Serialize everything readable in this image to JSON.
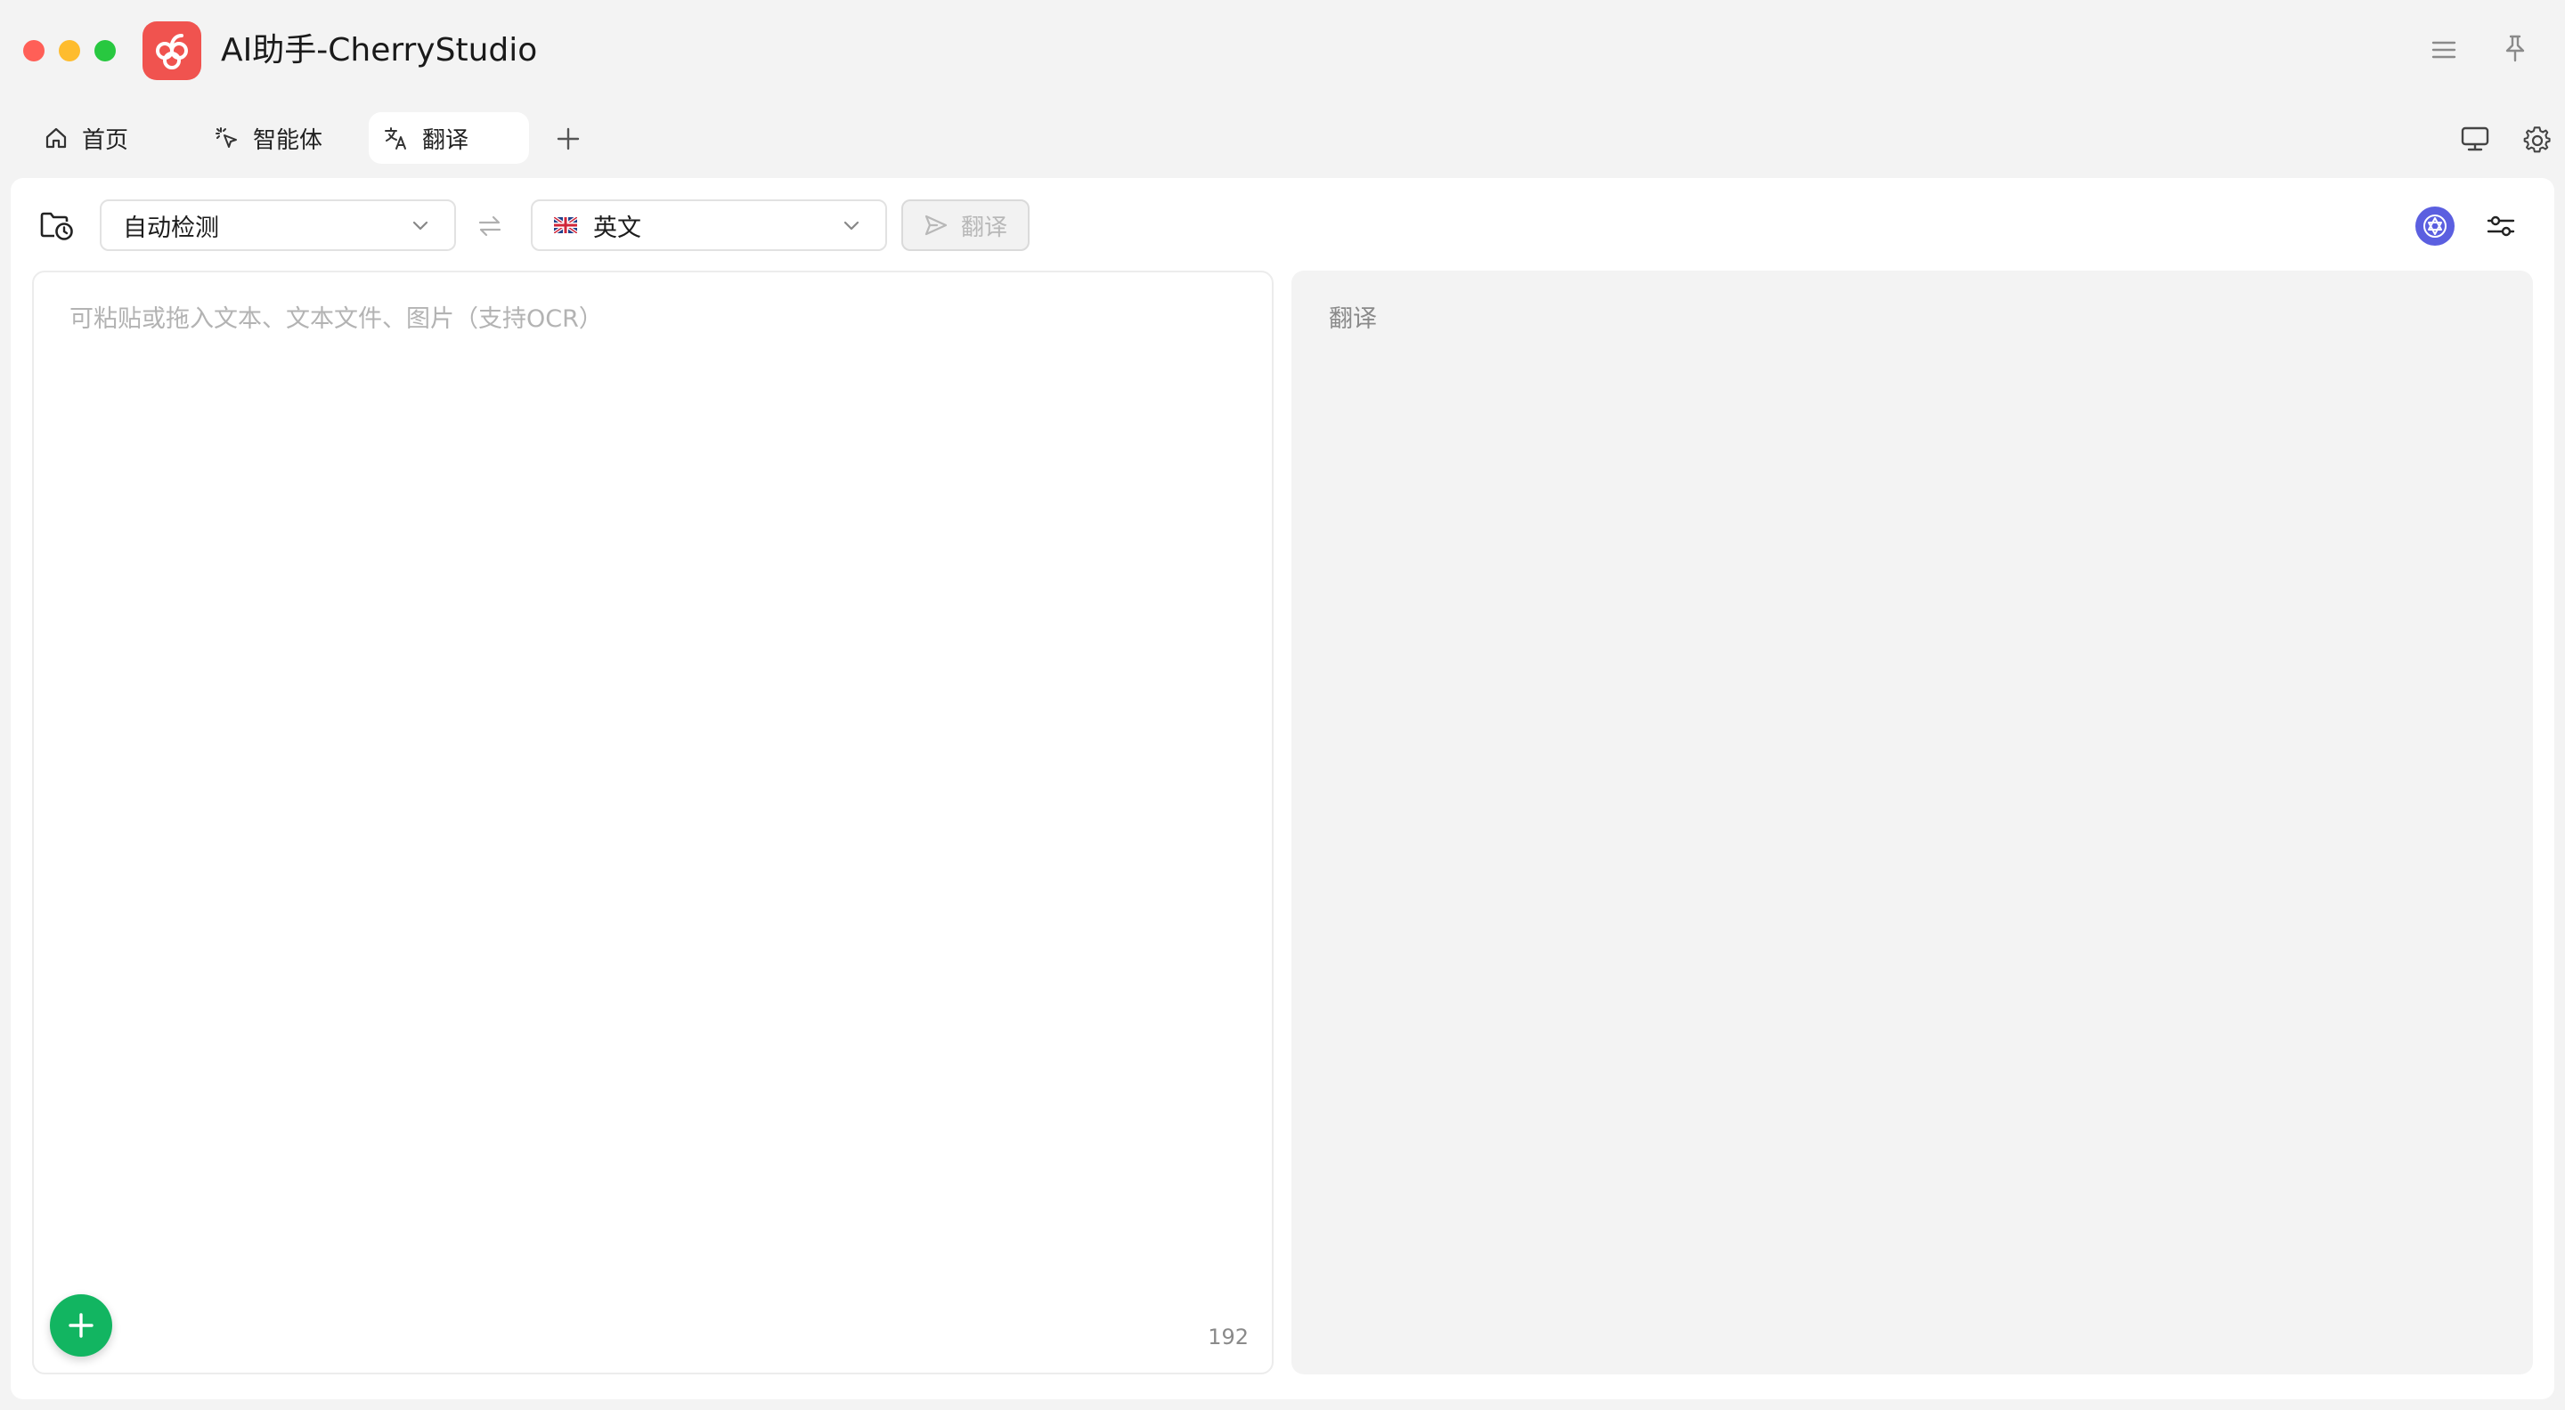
{
  "app": {
    "title": "AI助手-CherryStudio",
    "logo_icon": "cherry-logo-icon",
    "brand_color": "#f0534f"
  },
  "titlebar": {
    "menu_icon": "menu-icon",
    "pin_icon": "pin-icon"
  },
  "tabs": [
    {
      "label": "首页",
      "icon": "home-icon",
      "active": false
    },
    {
      "label": "智能体",
      "icon": "sparkle-cursor-icon",
      "active": false
    },
    {
      "label": "翻译",
      "icon": "translate-icon",
      "active": true
    }
  ],
  "tabbar_right": {
    "monitor_icon": "monitor-icon",
    "settings_icon": "gear-icon"
  },
  "toolbar": {
    "history_icon": "folder-clock-icon",
    "source_language": "自动检测",
    "swap_icon": "swap-arrows-icon",
    "target_language": "英文",
    "target_flag": "uk-flag-icon",
    "translate_button": "翻译",
    "model_icon": "model-logo-icon",
    "settings_icon": "sliders-icon"
  },
  "source": {
    "placeholder": "可粘贴或拖入文本、文本文件、图片（支持OCR）",
    "value": "",
    "char_count": "192"
  },
  "result": {
    "placeholder": "翻译"
  },
  "fab": {
    "icon": "plus-icon",
    "color": "#12b561"
  }
}
